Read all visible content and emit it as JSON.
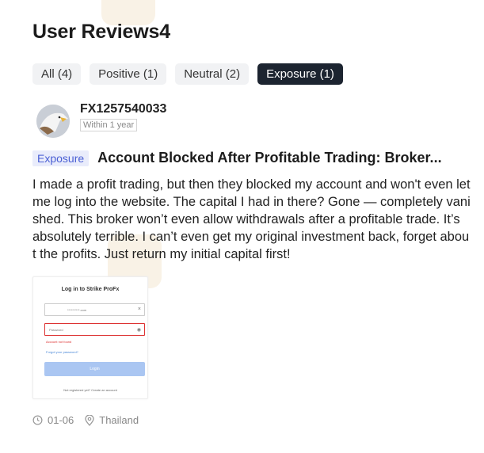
{
  "page": {
    "title": "User Reviews4"
  },
  "tabs": [
    {
      "label": "All (4)",
      "active": false
    },
    {
      "label": "Positive (1)",
      "active": false
    },
    {
      "label": "Neutral (2)",
      "active": false
    },
    {
      "label": "Exposure (1)",
      "active": true
    }
  ],
  "review": {
    "username": "FX1257540033",
    "time_badge": "Within 1 year",
    "tag": "Exposure",
    "title": "Account Blocked After Profitable Trading: Broker...",
    "body": "I made a profit trading, but then they blocked my account and won't even let me log into the website. The capital I had in there? Gone — completely vanished. This broker won’t even allow withdrawals after a profitable trade. It’s absolutely terrible. I can’t even get my original investment back, forget about the profits. Just return my initial capital first!",
    "screenshot": {
      "title": "Log in to Strike ProFx",
      "field1": "**********.com",
      "field2": "Password",
      "error": "Account not found",
      "forgot": "Forgot your password?",
      "button": "Login",
      "register": "Not registered yet? Create an account"
    },
    "date": "01-06",
    "location": "Thailand"
  },
  "colors": {
    "accent": "#4a5fd4",
    "active_tab_bg": "#1c2430",
    "tag_bg": "#e9ecfb"
  },
  "icons": {
    "date": "clock-icon",
    "location": "location-pin-icon"
  }
}
